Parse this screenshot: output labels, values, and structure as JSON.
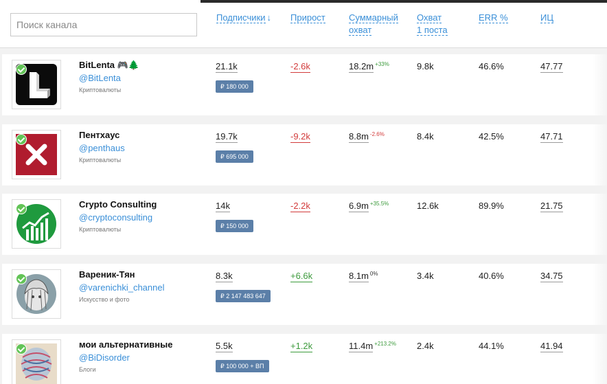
{
  "search": {
    "placeholder": "Поиск канала"
  },
  "columns": {
    "subscribers": "Подписчики",
    "sort_arrow": "↓",
    "growth": "Прирост",
    "total_reach_l1": "Суммарный",
    "total_reach_l2": "охват",
    "post_reach_l1": "Охват",
    "post_reach_l2": "1 поста",
    "err": "ERR %",
    "ic": "ИЦ"
  },
  "channels": [
    {
      "name": "BitLenta 🎮🌲",
      "handle": "@BitLenta",
      "category": "Криптовалюты",
      "price": "₽  180 000",
      "subscribers": "21.1k",
      "growth": "-2.6k",
      "growth_sign": "neg",
      "total_reach": "18.2m",
      "total_reach_delta": "+33%",
      "delta_sign": "pos",
      "post_reach": "9.8k",
      "err": "46.6%",
      "ic": "47.77"
    },
    {
      "name": "Пентхаус",
      "handle": "@penthaus",
      "category": "Криптовалюты",
      "price": "₽  695 000",
      "subscribers": "19.7k",
      "growth": "-9.2k",
      "growth_sign": "neg",
      "total_reach": "8.8m",
      "total_reach_delta": "-2.6%",
      "delta_sign": "neg",
      "post_reach": "8.4k",
      "err": "42.5%",
      "ic": "47.71"
    },
    {
      "name": "Crypto Consulting",
      "handle": "@cryptoconsulting",
      "category": "Криптовалюты",
      "price": "₽  150 000",
      "subscribers": "14k",
      "growth": "-2.2k",
      "growth_sign": "neg",
      "total_reach": "6.9m",
      "total_reach_delta": "+35.5%",
      "delta_sign": "pos",
      "post_reach": "12.6k",
      "err": "89.9%",
      "ic": "21.75"
    },
    {
      "name": "Вареник-Тян",
      "handle": "@varenichki_channel",
      "category": "Искусство и фото",
      "price": "₽  2 147 483 647",
      "subscribers": "8.3k",
      "growth": "+6.6k",
      "growth_sign": "pos",
      "total_reach": "8.1m",
      "total_reach_delta": "0%",
      "delta_sign": "neu",
      "post_reach": "3.4k",
      "err": "40.6%",
      "ic": "34.75"
    },
    {
      "name": "мои альтернативные",
      "handle": "@BiDisorder",
      "category": "Блоги",
      "price": "₽  100 000 + ВП",
      "subscribers": "5.5k",
      "growth": "+1.2k",
      "growth_sign": "pos",
      "total_reach": "11.4m",
      "total_reach_delta": "+213.2%",
      "delta_sign": "pos",
      "post_reach": "2.4k",
      "err": "44.1%",
      "ic": "41.94"
    }
  ]
}
